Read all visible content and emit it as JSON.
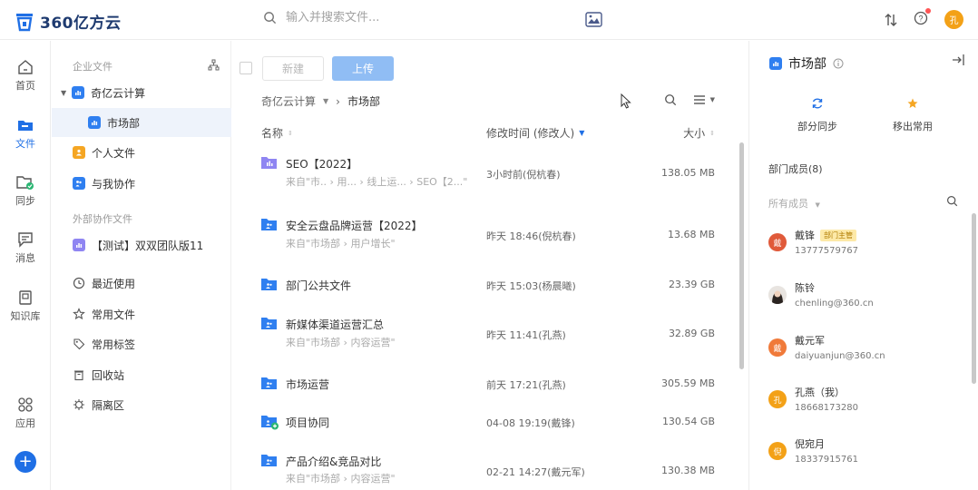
{
  "header": {
    "app_name": "360亿方云",
    "search_placeholder": "输入并搜索文件...",
    "avatar_text": "孔",
    "brand_color": "#1f6fe5"
  },
  "rail": {
    "items": [
      {
        "label": "首页",
        "icon": "home-icon"
      },
      {
        "label": "文件",
        "icon": "folder-icon",
        "active": true
      },
      {
        "label": "同步",
        "icon": "sync-folder-icon"
      },
      {
        "label": "消息",
        "icon": "message-icon"
      },
      {
        "label": "知识库",
        "icon": "knowledge-icon"
      },
      {
        "label": "应用",
        "icon": "apps-icon"
      }
    ]
  },
  "tree": {
    "enterprise_header": "企业文件",
    "external_header": "外部协作文件",
    "items": {
      "company": "奇亿云计算",
      "market_dept": "市场部",
      "personal": "个人文件",
      "collab": "与我协作",
      "external_team": "【测试】双双团队版11",
      "recent": "最近使用",
      "favorites": "常用文件",
      "tags": "常用标签",
      "recycle": "回收站",
      "quarantine": "隔离区"
    }
  },
  "main": {
    "new_label": "新建",
    "upload_label": "上传",
    "breadcrumb": {
      "parent": "奇亿云计算",
      "sep": "›",
      "current": "市场部"
    },
    "columns": {
      "name": "名称",
      "mtime": "修改时间 (修改人)",
      "size": "大小"
    },
    "rows": [
      {
        "name": "SEO【2022】",
        "path": "来自\"市..  ›  用...  ›  线上运...  ›  SEO【2...\"",
        "mtime": "3小时前(倪杭春)",
        "size": "138.05 MB",
        "icon": "purple"
      },
      {
        "name": "安全云盘品牌运营【2022】",
        "path": "来自\"市场部  ›  用户增长\"",
        "mtime": "昨天 18:46(倪杭春)",
        "size": "13.68 MB",
        "icon": "blue"
      },
      {
        "name": "部门公共文件",
        "path": "",
        "mtime": "昨天 15:03(杨晨曦)",
        "size": "23.39 GB",
        "icon": "blue"
      },
      {
        "name": "新媒体渠道运营汇总",
        "path": "来自\"市场部  ›  内容运营\"",
        "mtime": "昨天 11:41(孔燕)",
        "size": "32.89 GB",
        "icon": "blue"
      },
      {
        "name": "市场运营",
        "path": "",
        "mtime": "前天 17:21(孔燕)",
        "size": "305.59 MB",
        "icon": "blue"
      },
      {
        "name": "项目协同",
        "path": "",
        "mtime": "04-08 19:19(戴锋)",
        "size": "130.54 GB",
        "icon": "blue-green"
      },
      {
        "name": "产品介绍&竞品对比",
        "path": "来自\"市场部  ›  内容运营\"",
        "mtime": "02-21 14:27(戴元军)",
        "size": "130.38 MB",
        "icon": "blue"
      }
    ]
  },
  "panel": {
    "title": "市场部",
    "partial_sync": "部分同步",
    "remove_fav": "移出常用",
    "members_title": "部门成员(8)",
    "filter_label": "所有成员",
    "members": [
      {
        "name": "戴锋",
        "badge": "部门主管",
        "contact": "13777579767",
        "avatar": "戴",
        "color": "#e05a3a"
      },
      {
        "name": "陈铃",
        "badge": "",
        "contact": "chenling@360.cn",
        "avatar": "",
        "color": "#3a3a3a"
      },
      {
        "name": "戴元军",
        "badge": "",
        "contact": "daiyuanjun@360.cn",
        "avatar": "戴",
        "color": "#f07a3a"
      },
      {
        "name": "孔燕（我）",
        "badge": "",
        "contact": "18668173280",
        "avatar": "孔",
        "color": "#f3a117"
      },
      {
        "name": "倪宛月",
        "badge": "",
        "contact": "18337915761",
        "avatar": "倪",
        "color": "#f3a117"
      }
    ]
  }
}
